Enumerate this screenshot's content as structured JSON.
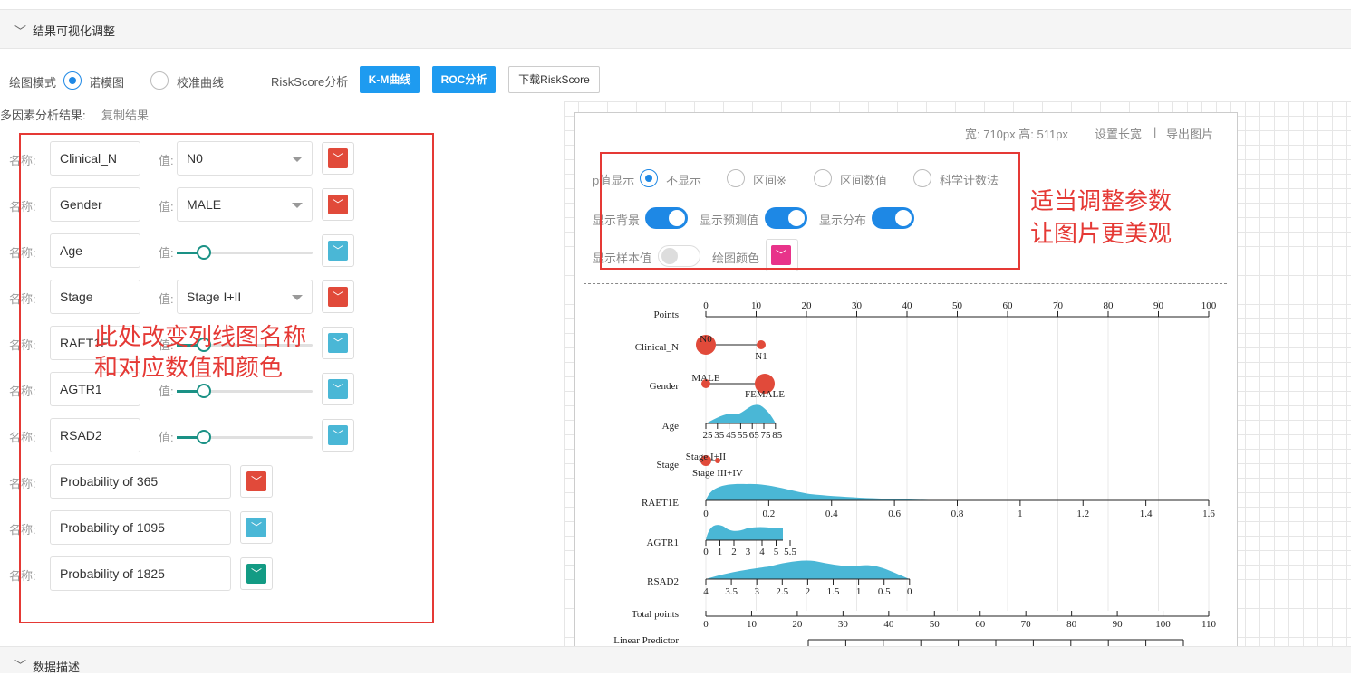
{
  "panel_title": "结果可视化调整",
  "footer_title": "数据描述",
  "mode": {
    "label": "绘图模式",
    "option1": "诺模图",
    "option2": "校准曲线"
  },
  "riskscore": {
    "label": "RiskScore分析",
    "km": "K-M曲线",
    "roc": "ROC分析",
    "download": "下载RiskScore"
  },
  "multi": {
    "label": "多因素分析结果:",
    "copy": "复制结果"
  },
  "vars": [
    {
      "name": "Clinical_N",
      "value": "N0",
      "color": "#e14a3a",
      "type": "select"
    },
    {
      "name": "Gender",
      "value": "MALE",
      "color": "#e14a3a",
      "type": "select"
    },
    {
      "name": "Age",
      "color": "#4ab7d6",
      "type": "slider",
      "level": 0.2
    },
    {
      "name": "Stage",
      "value": "Stage I+II",
      "color": "#e14a3a",
      "type": "select"
    },
    {
      "name": "RAET1E",
      "color": "#4ab7d6",
      "type": "slider",
      "level": 0.2
    },
    {
      "name": "AGTR1",
      "color": "#4ab7d6",
      "type": "slider",
      "level": 0.2
    },
    {
      "name": "RSAD2",
      "color": "#4ab7d6",
      "type": "slider",
      "level": 0.2
    }
  ],
  "probs": [
    {
      "name": "Probability of 365",
      "color": "#e14a3a"
    },
    {
      "name": "Probability of 1095",
      "color": "#4ab7d6"
    },
    {
      "name": "Probability of 1825",
      "color": "#139b84"
    }
  ],
  "field_labels": {
    "name": "名称:",
    "value": "值:"
  },
  "annotation_left": [
    "此处改变列线图名称",
    "和对应数值和颜色"
  ],
  "annotation_right": [
    "适当调整参数",
    "让图片更美观"
  ],
  "size": {
    "text": "宽: 710px 高: 511px",
    "set": "设置长宽",
    "sep": "|",
    "export": "导出图片"
  },
  "pval": {
    "label": "p值显示",
    "options": [
      "不显示",
      "区间※",
      "区间数值",
      "科学计数法"
    ]
  },
  "toggles": [
    {
      "label": "显示背景",
      "on": true
    },
    {
      "label": "显示预测值",
      "on": true
    },
    {
      "label": "显示分布",
      "on": true
    },
    {
      "label": "显示样本值",
      "on": false
    }
  ],
  "plot_color_label": "绘图颜色",
  "plot_color": "#e8338a",
  "chart_data": {
    "type": "nomogram",
    "rows": [
      {
        "label": "Points",
        "ticks": [
          "0",
          "10",
          "20",
          "30",
          "40",
          "50",
          "60",
          "70",
          "80",
          "90",
          "100"
        ]
      },
      {
        "label": "Clinical_N",
        "levels": [
          "N0",
          "N1"
        ]
      },
      {
        "label": "Gender",
        "levels": [
          "MALE",
          "FEMALE"
        ]
      },
      {
        "label": "Age",
        "ticks": [
          "25",
          "35",
          "45",
          "55",
          "65",
          "75",
          "85"
        ]
      },
      {
        "label": "Stage",
        "levels": [
          "Stage I+II",
          "Stage III+IV"
        ]
      },
      {
        "label": "RAET1E",
        "ticks": [
          "0",
          "0.2",
          "0.4",
          "0.6",
          "0.8",
          "1",
          "1.2",
          "1.4",
          "1.6"
        ]
      },
      {
        "label": "AGTR1",
        "ticks": [
          "0",
          "1",
          "2",
          "3",
          "4",
          "5",
          "5.5"
        ]
      },
      {
        "label": "RSAD2",
        "ticks": [
          "4",
          "3.5",
          "3",
          "2.5",
          "2",
          "1.5",
          "1",
          "0.5",
          "0"
        ]
      },
      {
        "label": "Total points",
        "ticks": [
          "0",
          "10",
          "20",
          "30",
          "40",
          "50",
          "60",
          "70",
          "80",
          "90",
          "100",
          "110"
        ]
      },
      {
        "label": "Linear Predictor"
      }
    ]
  }
}
